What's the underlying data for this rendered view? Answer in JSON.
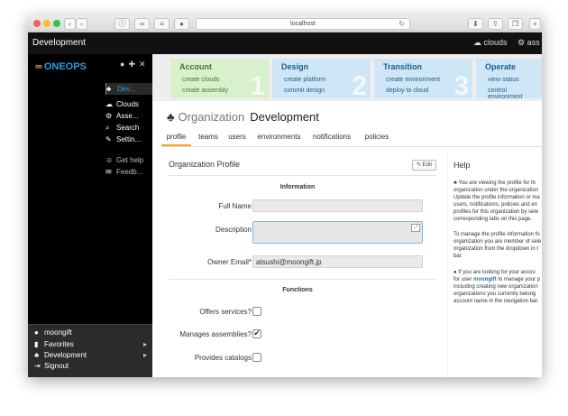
{
  "browser": {
    "url": "localhost",
    "icons": [
      "back-icon",
      "forward-icon",
      "info-icon",
      "link-icon",
      "layers-icon",
      "badge-icon",
      "download-icon",
      "share-icon",
      "tabs-icon",
      "new-tab-icon"
    ]
  },
  "header": {
    "title": "Development",
    "clouds_label": "clouds",
    "assemblies_label": "ass"
  },
  "sidebar": {
    "logo": "ONEOPS",
    "items": [
      {
        "label": "Dev..."
      },
      {
        "label": "Clouds"
      },
      {
        "label": "Asse..."
      },
      {
        "label": "Search"
      },
      {
        "label": "Settin..."
      },
      {
        "label": "Get help"
      },
      {
        "label": "Feedb..."
      }
    ],
    "bottom": [
      {
        "label": "moongift"
      },
      {
        "label": "Favorites"
      },
      {
        "label": "Development"
      },
      {
        "label": "Signout"
      }
    ]
  },
  "steps": [
    {
      "title": "Account",
      "links": [
        "create clouds",
        "create assembly"
      ],
      "number": "1"
    },
    {
      "title": "Design",
      "links": [
        "create platform",
        "commit design"
      ],
      "number": "2"
    },
    {
      "title": "Transition",
      "links": [
        "create environment",
        "deploy to cloud"
      ],
      "number": "3"
    },
    {
      "title": "Operate",
      "links": [
        "view status",
        "control environment"
      ],
      "number": "4"
    }
  ],
  "page": {
    "label": "Organization",
    "name": "Development"
  },
  "tabs": [
    "profile",
    "teams",
    "users",
    "environments",
    "notifications",
    "policies"
  ],
  "profile": {
    "title": "Organization Profile",
    "edit_label": "Edit",
    "information_heading": "Information",
    "full_name_label": "Full Name",
    "description_label": "Description",
    "owner_email_label": "Owner Email*",
    "owner_email_value": "atsushi@moongift.jp",
    "functions_heading": "Functions",
    "offers_services_label": "Offers services?",
    "manages_assemblies_label": "Manages assemblies?",
    "provides_catalogs_label": "Provides catalogs",
    "offers_services_checked": false,
    "manages_assemblies_checked": true,
    "provides_catalogs_checked": false
  },
  "help": {
    "title": "Help",
    "p1_lines": [
      "You are viewing the profile for th",
      "organization under the organization",
      "Update the profile information or ma",
      "users, notifications, policies and en",
      "profiles for this organization by sele",
      "corresponding tabs on this page."
    ],
    "p2_lines": [
      "To manage the profile information fo",
      "organization you are member of sele",
      "organization from the dropdown in t",
      "bar."
    ],
    "p3_line1": "If you are looking for your accou",
    "p3_prefix": "for user ",
    "p3_user": "moongift",
    "p3_suffix": " to manage your p",
    "p3_lines": [
      "including creating new organization",
      "organizations you currently belong",
      "account name in the navigation bar."
    ]
  }
}
